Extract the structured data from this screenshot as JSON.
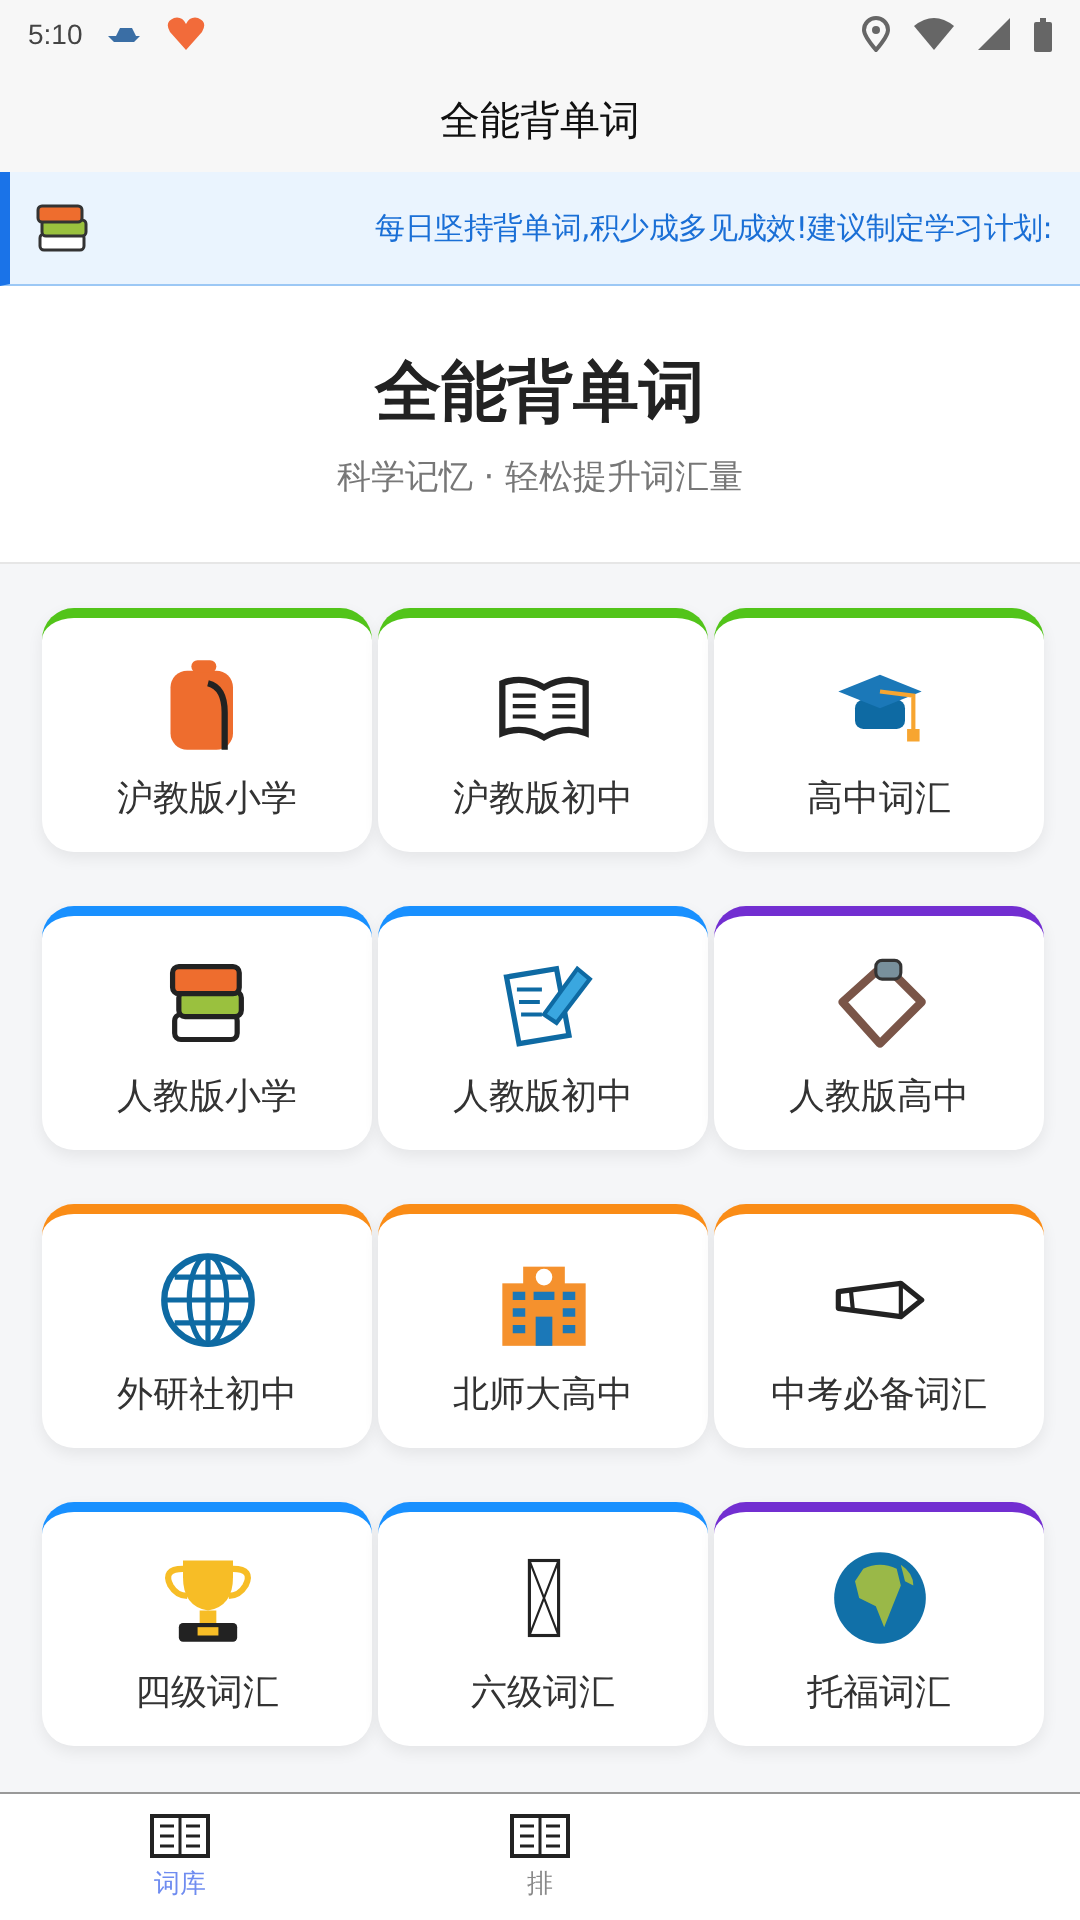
{
  "status_bar": {
    "time": "5:10"
  },
  "app_bar": {
    "title": "全能背单词"
  },
  "banner": {
    "text": "每日坚持背单词,积少成多见成效!建议制定学习计划:"
  },
  "hero": {
    "title": "全能背单词",
    "subtitle": "科学记忆 · 轻松提升词汇量"
  },
  "cards": [
    {
      "label": "沪教版小学",
      "color": "#52c41a"
    },
    {
      "label": "沪教版初中",
      "color": "#52c41a"
    },
    {
      "label": "高中词汇",
      "color": "#52c41a"
    },
    {
      "label": "人教版小学",
      "color": "#1890ff"
    },
    {
      "label": "人教版初中",
      "color": "#1890ff"
    },
    {
      "label": "人教版高中",
      "color": "#722ed1"
    },
    {
      "label": "外研社初中",
      "color": "#fa8c16"
    },
    {
      "label": "北师大高中",
      "color": "#fa8c16"
    },
    {
      "label": "中考必备词汇",
      "color": "#fa8c16"
    },
    {
      "label": "四级词汇",
      "color": "#1890ff"
    },
    {
      "label": "六级词汇",
      "color": "#1890ff"
    },
    {
      "label": "托福词汇",
      "color": "#722ed1"
    }
  ],
  "bottom_nav": [
    {
      "label": "词库",
      "selected": true
    },
    {
      "label": "排",
      "selected": false
    }
  ]
}
